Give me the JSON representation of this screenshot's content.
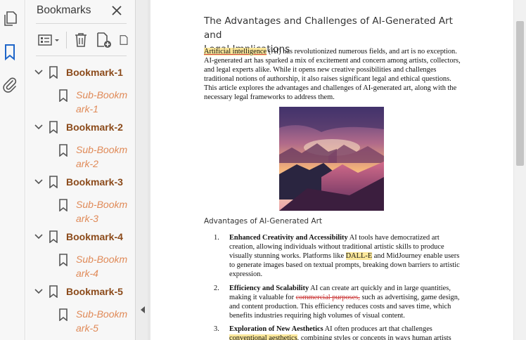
{
  "rail": {
    "pages_icon": "pages-icon",
    "bookmarks_icon": "bookmark-icon",
    "attachments_icon": "paperclip-icon",
    "active_color": "#1f66c9"
  },
  "panel": {
    "title": "Bookmarks",
    "bookmarks": [
      {
        "label": "Bookmark-1",
        "sub": [
          "Sub-Bookm",
          "ark-1"
        ]
      },
      {
        "label": "Bookmark-2",
        "sub": [
          "Sub-Bookm",
          "ark-2"
        ]
      },
      {
        "label": "Bookmark-3",
        "sub": [
          "Sub-Bookm",
          "ark-3"
        ]
      },
      {
        "label": "Bookmark-4",
        "sub": [
          "Sub-Bookm",
          "ark-4"
        ]
      },
      {
        "label": "Bookmark-5",
        "sub": [
          "Sub-Bookm",
          "ark-5"
        ]
      }
    ],
    "bookmark_color": "#8b4a1a",
    "sub_bookmark_color": "#e08a58"
  },
  "document": {
    "title_line1": "The Advantages and Challenges of AI-Generated Art and",
    "title_line2": "Legal Implications",
    "intro_highlight": "Artificial intelligence",
    "intro_rest": " (AI) has revolutionized numerous fields, and art is no exception. AI-generated art has sparked a mix of excitement and concern among artists, collectors, and legal experts alike. While it opens new creative possibilities and challenges traditional notions of authorship, it also raises significant legal and ethical questions. This article explores the advantages and challenges of AI-generated art, along with the necessary legal frameworks to address them.",
    "image_alt": "mountain sunset painting",
    "subheading": "Advantages of AI-Generated Art",
    "items": [
      {
        "num": "1.",
        "heading": "Enhanced Creativity and Accessibility",
        "text_a": " AI tools have democratized art creation, allowing individuals without traditional artistic skills to produce visually stunning works. Platforms like ",
        "highlight": "DALL-E",
        "text_b": " and MidJourney enable users to generate images based on textual prompts, breaking down barriers to artistic expression."
      },
      {
        "num": "2.",
        "heading": "Efficiency and Scalability",
        "text_a": " AI can create art quickly and in large quantities, making it valuable for ",
        "strike": "commercial purposes,",
        "text_b": " such as advertising, game design, and content production. This efficiency reduces costs and saves time, which benefits industries requiring high volumes of visual content."
      },
      {
        "num": "3.",
        "heading": "Exploration of New Aesthetics",
        "text_a": " AI often produces art that challenges ",
        "highlight": "conventional aesthetics",
        "text_b": ", combining styles or concepts in ways human artists"
      }
    ]
  }
}
